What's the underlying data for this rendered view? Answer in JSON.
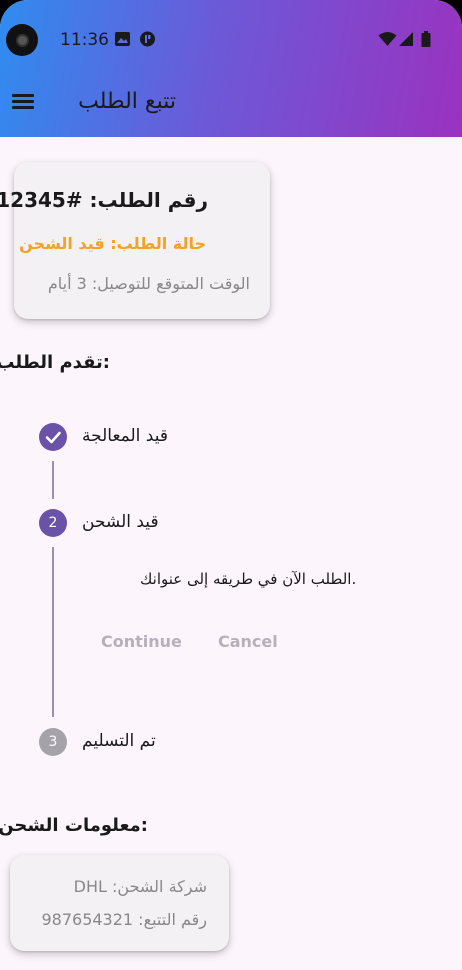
{
  "status_bar": {
    "time": "11:36",
    "icons": [
      "camera-cutout",
      "gallery-notification-icon",
      "app-notification-icon",
      "wifi-icon",
      "signal-icon",
      "battery-icon"
    ]
  },
  "app_bar": {
    "title": "تتبع الطلب",
    "menu_icon": "hamburger-menu-icon",
    "gradient": [
      "#2f8cf0",
      "#6b5ad8",
      "#9a32c0"
    ]
  },
  "order_card": {
    "number": "رقم الطلب: #12345",
    "status": "حالة الطلب: قيد الشحن",
    "status_color": "#f2a224",
    "eta": "الوقت المتوقع للتوصيل: 3 أيام"
  },
  "progress": {
    "title": ":تقدم الطلب",
    "steps": [
      {
        "label": "قيد المعالجة",
        "state": "completed",
        "badge": "✓",
        "color": "#6a52a8"
      },
      {
        "label": "قيد الشحن",
        "state": "active",
        "badge": "2",
        "color": "#6a52a8"
      },
      {
        "label": "تم التسليم",
        "state": "pending",
        "badge": "3",
        "color": "#a6a2aa"
      }
    ],
    "active_content": ".الطلب الآن في طريقه إلى عنوانك",
    "continue_label": "Continue",
    "cancel_label": "Cancel"
  },
  "shipping": {
    "title": ":معلومات الشحن",
    "company": "شركة الشحن: DHL",
    "tracking": "رقم التتبع: 987654321"
  }
}
